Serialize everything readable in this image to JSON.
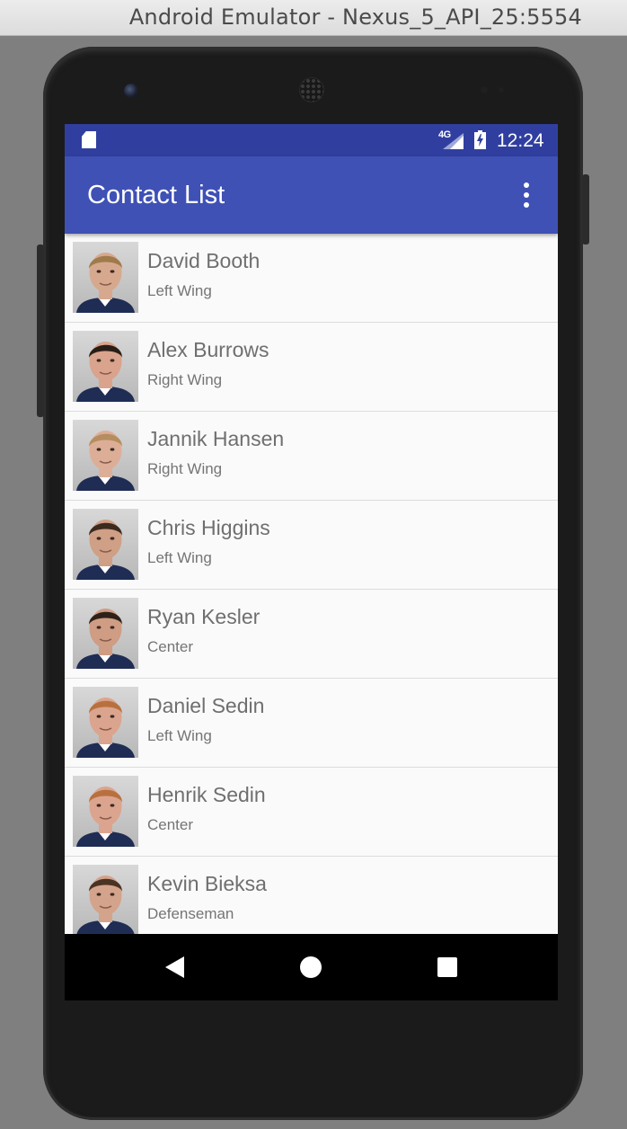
{
  "window": {
    "title": "Android Emulator - Nexus_5_API_25:5554"
  },
  "statusbar": {
    "time": "12:24",
    "network": "4G",
    "icons": [
      "sd-card-icon",
      "signal-icon",
      "battery-charging-icon"
    ]
  },
  "appbar": {
    "title": "Contact List",
    "menu_icon": "overflow-menu-icon"
  },
  "contacts": [
    {
      "name": "David Booth",
      "position": "Left Wing",
      "skin": "#d6a98e",
      "hair": "#a07a4a"
    },
    {
      "name": "Alex Burrows",
      "position": "Right Wing",
      "skin": "#d9a38d",
      "hair": "#2a1d16"
    },
    {
      "name": "Jannik Hansen",
      "position": "Right Wing",
      "skin": "#dcae97",
      "hair": "#b58d5e"
    },
    {
      "name": "Chris Higgins",
      "position": "Left Wing",
      "skin": "#cf9f86",
      "hair": "#3b2a1e"
    },
    {
      "name": "Ryan Kesler",
      "position": "Center",
      "skin": "#cf9c84",
      "hair": "#2e2119"
    },
    {
      "name": "Daniel Sedin",
      "position": "Left Wing",
      "skin": "#dba48e",
      "hair": "#b8703e"
    },
    {
      "name": "Henrik Sedin",
      "position": "Center",
      "skin": "#dba48e",
      "hair": "#b8703e"
    },
    {
      "name": "Kevin Bieksa",
      "position": "Defenseman",
      "skin": "#d4a38b",
      "hair": "#4a3322"
    }
  ],
  "colors": {
    "status_bar": "#303f9f",
    "app_bar": "#3f51b5",
    "list_bg": "#fafafa",
    "jersey": "#1f2d55"
  },
  "navbar": {
    "icons": [
      "back-icon",
      "home-icon",
      "recents-icon"
    ]
  }
}
